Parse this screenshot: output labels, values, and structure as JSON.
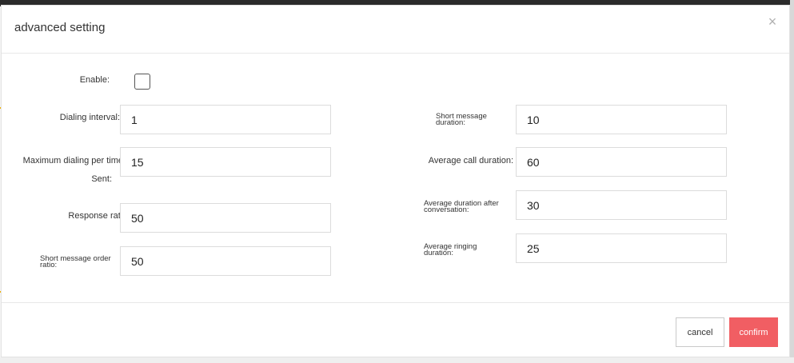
{
  "dialog": {
    "title": "advanced setting",
    "close_glyph": "×",
    "close_icon": "close-icon"
  },
  "form": {
    "enable": {
      "label": "Enable:",
      "checked": false
    },
    "dialing_interval": {
      "label": "Dialing interval:",
      "value": "1"
    },
    "max_dialing_per_time": {
      "label_line1": "Maximum dialing per time",
      "label_line2": "Sent:",
      "value": "15"
    },
    "response_rate": {
      "label": "Response rate:",
      "value": "50"
    },
    "short_message_order_ratio": {
      "label_line1": "Short message order",
      "label_line2": "ratio:",
      "value": "50"
    },
    "short_message_duration": {
      "label_line1": "Short message",
      "label_line2": "duration:",
      "value": "10"
    },
    "average_call_duration": {
      "label": "Average call duration:",
      "value": "60"
    },
    "average_duration_after_conversation": {
      "label_line1": "Average duration after",
      "label_line2": "conversation:",
      "value": "30"
    },
    "average_ringing_duration": {
      "label_line1": "Average ringing",
      "label_line2": "duration:",
      "value": "25"
    }
  },
  "footer": {
    "cancel_label": "cancel",
    "confirm_label": "confirm"
  },
  "colors": {
    "confirm_bg": "#f15e63",
    "checkbox_border": "#555555"
  }
}
